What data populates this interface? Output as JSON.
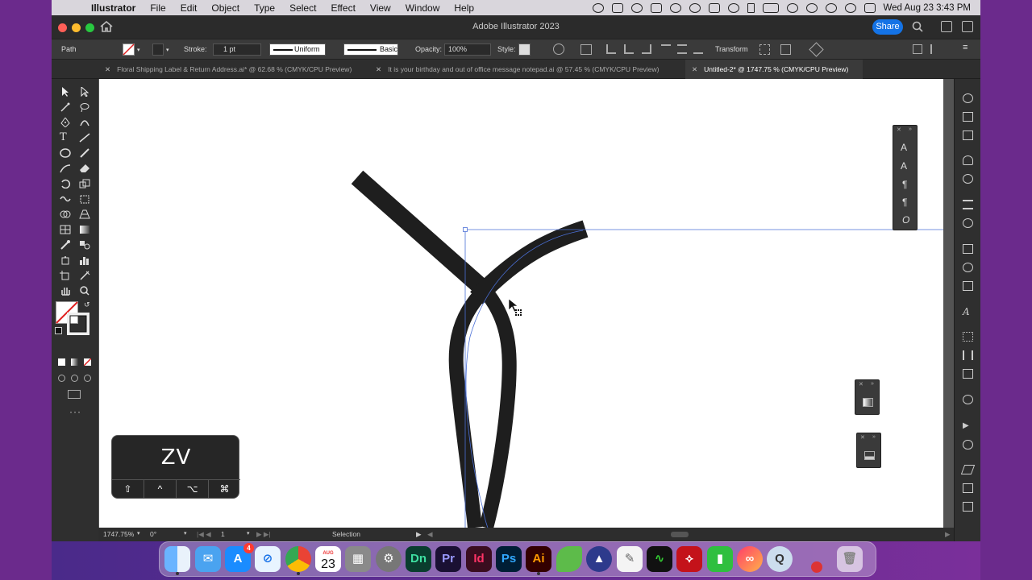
{
  "menubar": {
    "app_name": "Illustrator",
    "items": [
      "File",
      "Edit",
      "Object",
      "Type",
      "Select",
      "Effect",
      "View",
      "Window",
      "Help"
    ],
    "clock": "Wed Aug 23  3:43 PM"
  },
  "titlebar": {
    "title": "Adobe Illustrator 2023",
    "share_label": "Share"
  },
  "controlbar": {
    "selection_type": "Path",
    "stroke_label": "Stroke:",
    "stroke_weight": "1 pt",
    "profile": "Uniform",
    "brush": "Basic",
    "opacity_label": "Opacity:",
    "opacity_value": "100%",
    "style_label": "Style:",
    "transform_label": "Transform"
  },
  "tabs": [
    {
      "label": "Floral Shipping Label & Return Address.ai* @ 62.68 % (CMYK/CPU Preview)",
      "active": false
    },
    {
      "label": "It is your birthday and out of office message notepad.ai @ 57.45 % (CMYK/CPU Preview)",
      "active": false
    },
    {
      "label": "Untitled-2* @ 1747.75 % (CMYK/CPU Preview)",
      "active": true
    }
  ],
  "statusbar": {
    "zoom": "1747.75%",
    "rotation": "0°",
    "artboard": "1",
    "tool": "Selection"
  },
  "keyboard_overlay": {
    "keys": "ZV",
    "modifiers": [
      "⇧",
      "^",
      "⌥",
      "⌘"
    ]
  },
  "dock": {
    "calendar_month": "AUG",
    "calendar_day": "23",
    "appstore_badge": "4",
    "apps": [
      {
        "label": "Dn",
        "color": "#0a3d2e",
        "fg": "#3ee0a1"
      },
      {
        "label": "Pr",
        "color": "#1a1033",
        "fg": "#9999ff"
      },
      {
        "label": "Id",
        "color": "#3a0d1f",
        "fg": "#ff3366"
      },
      {
        "label": "Ps",
        "color": "#001e36",
        "fg": "#31a8ff"
      },
      {
        "label": "Ai",
        "color": "#330000",
        "fg": "#ff9a00"
      }
    ]
  },
  "colors": {
    "accent": "#1473e6",
    "stroke_path": "#1e1e1e",
    "selection_guide": "#4a6fd6"
  }
}
